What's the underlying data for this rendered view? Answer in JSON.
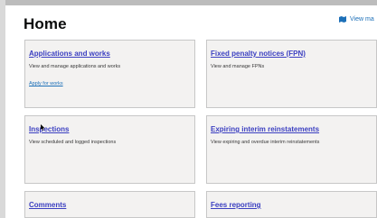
{
  "page": {
    "title": "Home",
    "header_link": "View ma",
    "header_link_icon": "map-icon"
  },
  "cards": [
    {
      "title": "Applications and works",
      "description": "View and manage applications and works",
      "link": "Apply for works"
    },
    {
      "title": "Fixed penalty notices (FPN)",
      "description": "View and manage FPNs"
    },
    {
      "title": "Inspections",
      "description": "View scheduled and logged inspections"
    },
    {
      "title": "Expiring interim reinstatements",
      "description": "View expiring and overdue interim reinstatements"
    },
    {
      "title": "Comments"
    },
    {
      "title": "Fees reporting"
    }
  ],
  "colors": {
    "card_background": "#f3f2f1",
    "card_border": "#c7c7c7",
    "card_title": "#3b3fc1",
    "link": "#1d70b8",
    "text": "#0b0c0c"
  }
}
